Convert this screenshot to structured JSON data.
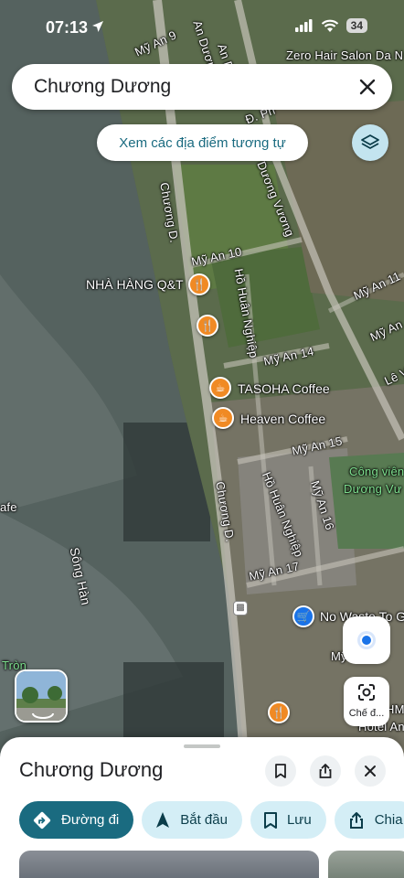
{
  "status_bar": {
    "time": "07:13",
    "battery": "34"
  },
  "search": {
    "query": "Chương Dương",
    "similar_button": "Xem các địa điểm tương tự"
  },
  "map": {
    "street_labels": {
      "my_an_9": "Mỹ An 9",
      "an_duong": "An Dương",
      "an_d2": "An D",
      "zero_hair": "Zero Hair Salon Da N",
      "d_ph": "Đ. Ph",
      "duong_vuong": "Dương Vương",
      "chuong_d_top": "Chương D.",
      "my_an_10": "Mỹ An 10",
      "ho_huan_nghiep_top": "Hồ Huân Nghiệp",
      "my_an_11": "Mỹ An 11",
      "my_an_top_right": "Mỹ An",
      "my_an_14": "Mỹ An 14",
      "le_v": "Lê V",
      "my_an_15": "Mỹ An 15",
      "cong_vien": "Công viên",
      "duong_vu": "Dương Vư",
      "ho_huan_nghiep_bottom": "Hồ Huân Nghiệp",
      "my_an_16": "Mỹ An 16",
      "chuong_d_bottom": "Chương D.",
      "afe": "afe",
      "song_han": "Sông Hàn",
      "my_an_17": "Mỹ An 17",
      "my": "Mỹ",
      "tron": "Tròn",
      "hm": "HM",
      "hotel_an": "Hotel An"
    },
    "poi_labels": {
      "nha_hang": "NHÀ HÀNG Q&T",
      "tasoha": "TASOHA Coffee",
      "heaven": "Heaven Coffee",
      "no_waste": "No Waste To G"
    }
  },
  "controls": {
    "lens_label": "Chế đ..."
  },
  "sheet": {
    "title": "Chương Dương",
    "actions": [
      {
        "label": "Đường đi",
        "icon": "directions-icon"
      },
      {
        "label": "Bắt đầu",
        "icon": "navigation-arrow-icon"
      },
      {
        "label": "Lưu",
        "icon": "bookmark-icon"
      },
      {
        "label": "Chia",
        "icon": "share-icon"
      }
    ]
  },
  "colors": {
    "accent": "#1a6b80",
    "chip_bg": "#d4eef6",
    "poi_orange": "#f08a24",
    "location_blue": "#1a73e8"
  }
}
